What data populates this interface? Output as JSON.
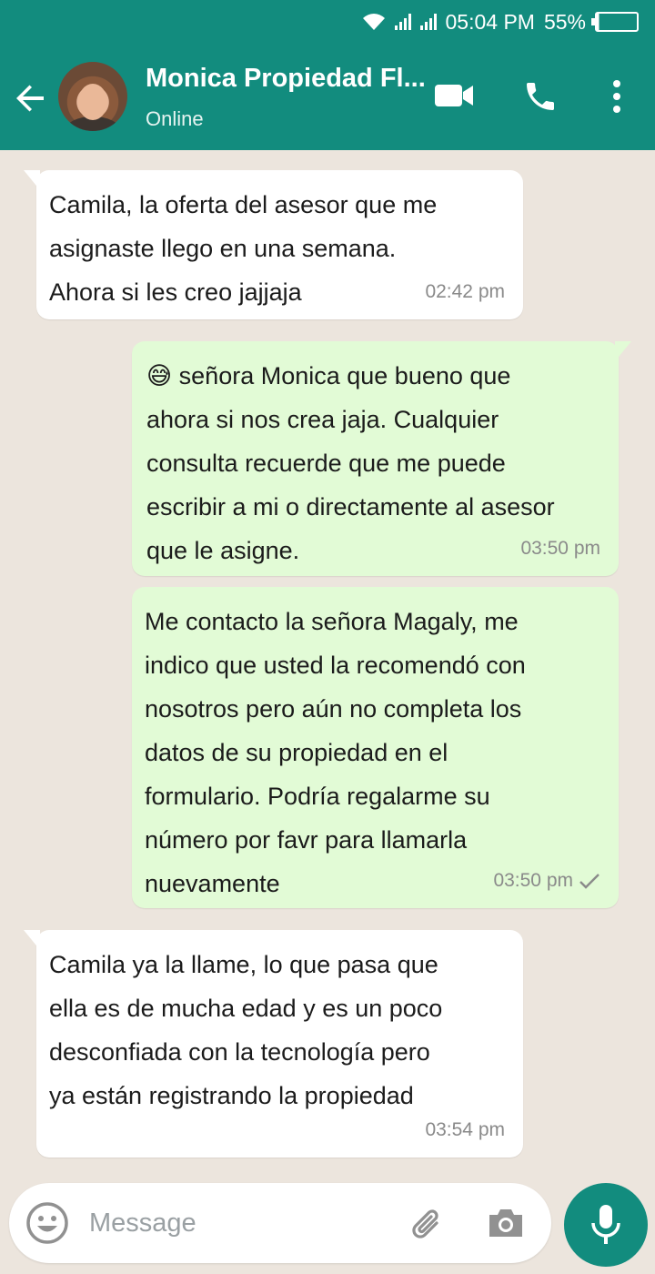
{
  "status_bar": {
    "time": "05:04 PM",
    "battery": "55%"
  },
  "header": {
    "contact_name": "Monica Propiedad Fl...",
    "status": "Online",
    "accent_color": "#128c7e"
  },
  "messages": [
    {
      "direction": "in",
      "text": " Camila, la oferta del asesor que me\nasignaste llego en una semana.\nAhora si les creo jajjaja",
      "time": "02:42 pm"
    },
    {
      "direction": "out",
      "emoji": "😅",
      "text": " señora Monica que bueno  que\nahora si nos crea jaja. Cualquier\nconsulta recuerde que me puede\nescribir a mi o directamente al asesor\nque le asigne.",
      "time": "03:50 pm"
    },
    {
      "direction": "out",
      "text": " Me contacto la señora Magaly, me\nindico que usted la recomendó con\nnosotros pero aún no completa los\ndatos de su propiedad en el\nformulario. Podría regalarme su\nnúmero por favr para llamarla\nnuevamente",
      "time": "03:50 pm",
      "status": "sent"
    },
    {
      "direction": "in",
      "text": " Camila ya la llame, lo que pasa que\nella es de mucha edad y es un poco\ndesconfiada con la tecnología  pero\nya están registrando la propiedad",
      "time": "03:54 pm"
    }
  ],
  "composer": {
    "placeholder": "Message"
  },
  "icons": [
    "back-arrow-icon",
    "video-call-icon",
    "phone-icon",
    "more-vert-icon",
    "emoji-icon",
    "attach-icon",
    "camera-icon",
    "mic-icon",
    "check-icon",
    "wifi-icon",
    "signal-icon",
    "battery-icon"
  ]
}
